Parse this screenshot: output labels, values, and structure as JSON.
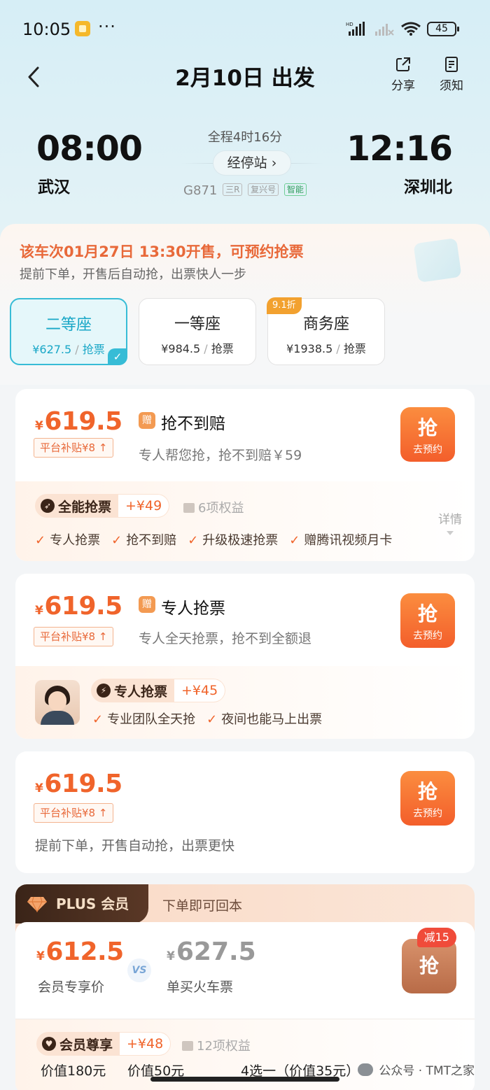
{
  "status": {
    "time": "10:05",
    "dots": "···",
    "hd": "HD",
    "battery": "45"
  },
  "nav": {
    "title": "2月10日 出发",
    "share": "分享",
    "notice": "须知"
  },
  "trip": {
    "dep_time": "08:00",
    "dep_station": "武汉",
    "arr_time": "12:16",
    "arr_station": "深圳北",
    "duration": "全程4时16分",
    "stops": "经停站 ›",
    "train_no": "G871",
    "tag1": "三R",
    "tag2": "复兴号",
    "tag3": "智能"
  },
  "sale": {
    "title": "该车次01月27日 13:30开售，可预约抢票",
    "sub": "提前下单，开售后自动抢，出票快人一步"
  },
  "seats": [
    {
      "name": "二等座",
      "price": "¥627.5",
      "action": "抢票",
      "active": true
    },
    {
      "name": "一等座",
      "price": "¥984.5",
      "action": "抢票"
    },
    {
      "name": "商务座",
      "price": "¥1938.5",
      "action": "抢票",
      "discount": "9.1折"
    }
  ],
  "card1": {
    "cur": "¥",
    "price": "619.5",
    "subsidy": "平台补贴¥8",
    "gift": "赠",
    "title": "抢不到赔",
    "desc": "专人帮您抢，抢不到赔￥59",
    "btn_big": "抢",
    "btn_small": "去预约",
    "perk_name": "全能抢票",
    "perk_plus": "+¥49",
    "benefits": "6项权益",
    "checks": [
      "专人抢票",
      "抢不到赔",
      "升级极速抢票",
      "赠腾讯视频月卡"
    ],
    "details": "详情"
  },
  "card2": {
    "cur": "¥",
    "price": "619.5",
    "subsidy": "平台补贴¥8",
    "gift": "赠",
    "title": "专人抢票",
    "desc": "专人全天抢票，抢不到全额退",
    "btn_big": "抢",
    "btn_small": "去预约",
    "perk_name": "专人抢票",
    "perk_plus": "+¥45",
    "checks": [
      "专业团队全天抢",
      "夜间也能马上出票"
    ]
  },
  "card3": {
    "cur": "¥",
    "price": "619.5",
    "subsidy": "平台补贴¥8",
    "btn_big": "抢",
    "btn_small": "去预约",
    "desc": "提前下单，开售自动抢，出票更快"
  },
  "plus": {
    "brand": "PLUS 会员",
    "slogan": "下单即可回本",
    "cur": "¥",
    "member_price": "612.5",
    "member_label": "会员专享价",
    "vs": "VS",
    "normal_price": "627.5",
    "normal_label": "单买火车票",
    "btn": "抢",
    "minus": "减15",
    "perk_name": "会员尊享",
    "perk_plus": "+¥48",
    "benefits": "12项权益",
    "cut_texts": [
      "价值180元",
      "价值50元",
      "4选一（价值35元）"
    ]
  },
  "watermark": "公众号 · TMT之家",
  "colors": {
    "accent": "#f0642b",
    "teal": "#37bcd6",
    "brown": "#3a2418"
  }
}
